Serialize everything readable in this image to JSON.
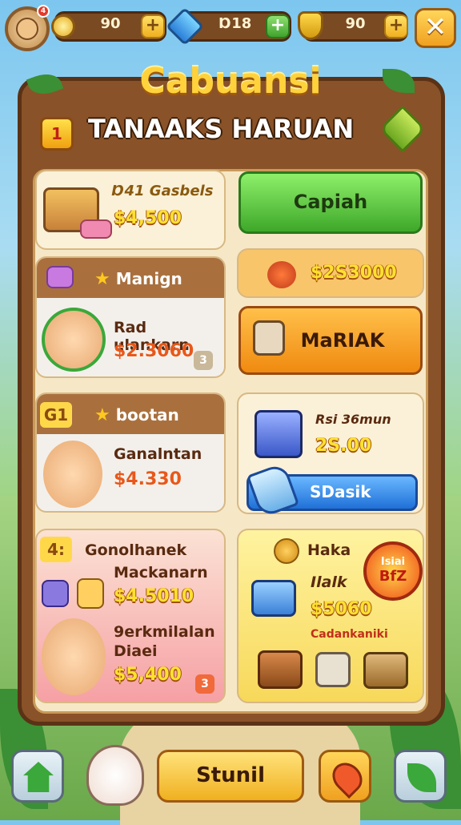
{
  "topbar": {
    "coins": "90",
    "gems": "Ɒ18",
    "shields": "90",
    "close_label": "✕",
    "avatar_badge": "4"
  },
  "panel": {
    "title": "Cabuansi",
    "subtitle": "TANAAKS HARUAN",
    "badge_label": "1"
  },
  "cards": {
    "crate": {
      "name": "Ɒ41 Gasbels",
      "price": "$4,500"
    },
    "buy_button": "Capiah",
    "manian": {
      "header": "Manign",
      "name": "Rad ulankarn",
      "price": "$2.3060",
      "count": "3"
    },
    "bonus_price": "$2S3000",
    "mariak_button": "MaRIAK",
    "bootan": {
      "header": "bootan",
      "badge": "G1",
      "name": "Ganalntan",
      "price": "$4.330"
    },
    "vehicle": {
      "name": "Rsi 36mun",
      "price": "2S.00"
    },
    "sdasik_button": "SDasik",
    "gonolhanek": {
      "badge": "4:",
      "title": "Gonolhanek",
      "line2": "Mackanarn",
      "price": "$4.5010",
      "name": "9erkmilalan",
      "line3": "Diaei",
      "price2": "$5,400",
      "count": "3"
    },
    "haka": {
      "title": "Haka",
      "sub": "Ilalk",
      "price": "$5060",
      "note": "Cadankaniki",
      "sale_line1": "Isiai",
      "sale_line2": "BfZ"
    }
  },
  "bottom": {
    "main_button": "Stunil"
  },
  "colors": {
    "panel_wood": "#8a5228",
    "panel_inner": "#f6e8c6",
    "green_button": "#3ea82a",
    "orange_button": "#f08a10",
    "title_gold": "#ffd23c"
  }
}
